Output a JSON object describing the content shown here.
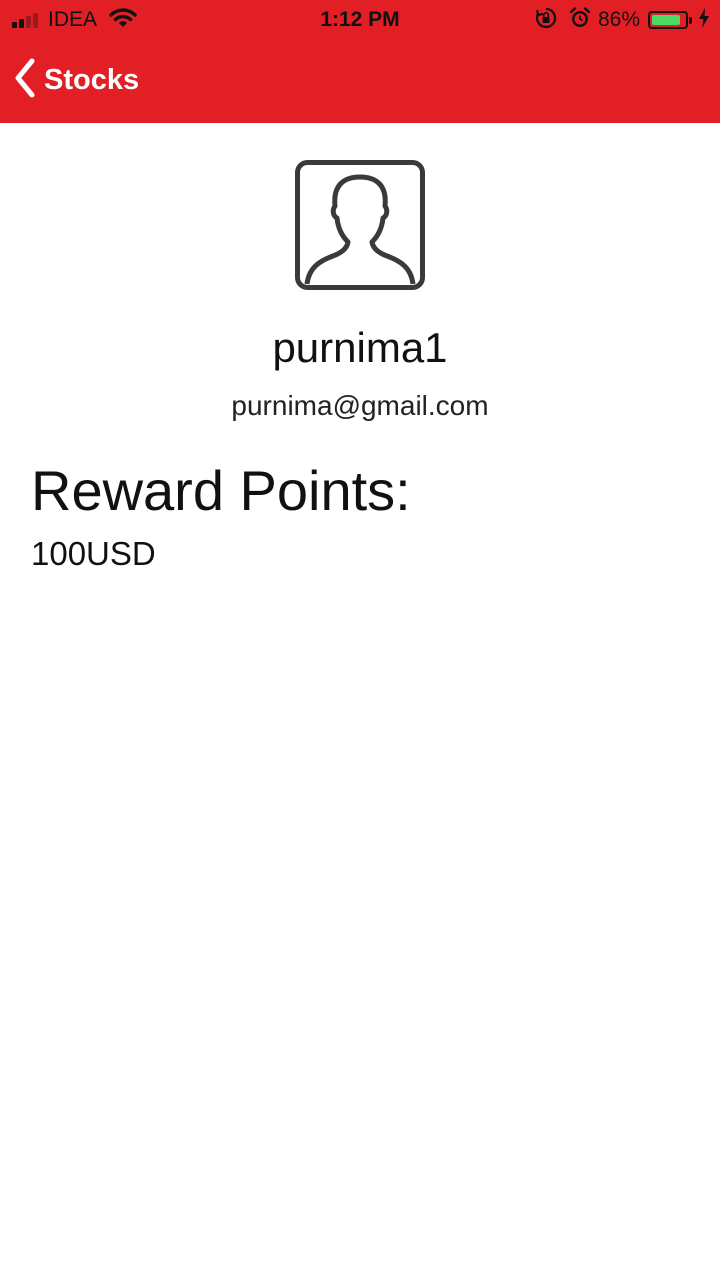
{
  "status_bar": {
    "carrier": "IDEA",
    "time": "1:12 PM",
    "battery_percent": "86%",
    "battery_level": 0.86,
    "signal_bars_active": 2,
    "signal_bars_total": 4,
    "icons": [
      "signal-icon",
      "wifi-icon",
      "rotation-lock-icon",
      "alarm-icon",
      "battery-icon",
      "charging-bolt-icon"
    ]
  },
  "nav": {
    "back_label": "Stocks",
    "background_color": "#e31f26"
  },
  "profile": {
    "avatar_icon": "user-avatar-icon",
    "username": "purnima1",
    "email": "purnima@gmail.com"
  },
  "rewards": {
    "heading": "Reward Points:",
    "value": "100USD"
  }
}
